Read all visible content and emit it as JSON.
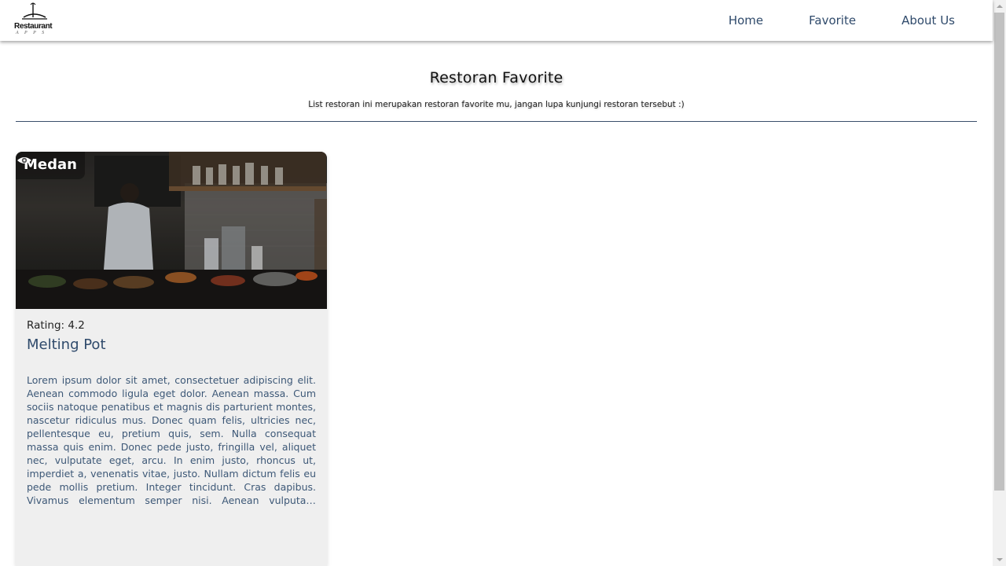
{
  "brand": {
    "logo_text": "Restaurant",
    "logo_sub": "A P P S"
  },
  "nav": {
    "items": [
      {
        "label": "Home"
      },
      {
        "label": "Favorite"
      },
      {
        "label": "About Us"
      }
    ]
  },
  "hero": {
    "title": "Restoran Favorite",
    "subtitle": "List restoran ini merupakan restoran favorite mu, jangan lupa kunjungi restoran tersebut :)"
  },
  "restaurants": [
    {
      "city": "Medan",
      "rating_text": "Rating: 4.2",
      "name": "Melting Pot",
      "description": "Lorem ipsum dolor sit amet, consectetuer adipiscing elit. Aenean commodo ligula eget dolor. Aenean massa. Cum sociis natoque penatibus et magnis dis parturient montes, nascetur ridiculus mus. Donec quam felis, ultricies nec, pellentesque eu, pretium quis, sem. Nulla consequat massa quis enim. Donec pede justo, fringilla vel, aliquet nec, vulputate eget, arcu. In enim justo, rhoncus ut, imperdiet a, venenatis vitae, justo. Nullam dictum felis eu pede mollis pretium. Integer tincidunt. Cras dapibus. Vivamus elementum semper nisi. Aenean vulputate eleifend tellus. Aenean l...",
      "icon": "eye-icon"
    }
  ],
  "colors": {
    "accent": "#2f4a6b",
    "card_bg": "#efefef",
    "divider": "#3a4f6a"
  }
}
